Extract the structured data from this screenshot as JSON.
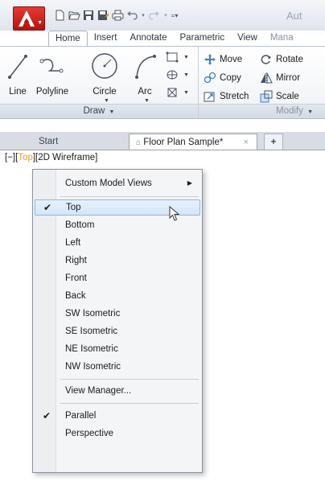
{
  "app": {
    "title_partial": "Aut",
    "title_partial2": "A"
  },
  "ribbon": {
    "tabs": [
      "Home",
      "Insert",
      "Annotate",
      "Parametric",
      "View",
      "Mana"
    ],
    "active_tab": "Home",
    "draw_panel": {
      "title": "Draw",
      "tools": [
        "Line",
        "Polyline",
        "Circle",
        "Arc"
      ]
    },
    "modify_panel": {
      "title": "Modify",
      "tools": [
        "Move",
        "Rotate",
        "Copy",
        "Mirror",
        "Stretch",
        "Scale"
      ]
    }
  },
  "doc_tabs": {
    "start": "Start",
    "file": "Floor Plan Sample*",
    "close": "×",
    "new": "+"
  },
  "viewport": {
    "controls_prefix": "[−][",
    "view": "Top",
    "controls_suffix": "][2D Wireframe]"
  },
  "menu": {
    "items": [
      {
        "label": "Custom Model Views",
        "submenu": true
      },
      {
        "label": "Top",
        "checked": true,
        "hover": true
      },
      {
        "label": "Bottom"
      },
      {
        "label": "Left"
      },
      {
        "label": "Right"
      },
      {
        "label": "Front"
      },
      {
        "label": "Back"
      },
      {
        "label": "SW Isometric"
      },
      {
        "label": "SE Isometric"
      },
      {
        "label": "NE Isometric"
      },
      {
        "label": "NW Isometric"
      },
      {
        "label": "View Manager..."
      },
      {
        "label": "Parallel",
        "checked": true
      },
      {
        "label": "Perspective"
      }
    ]
  },
  "colors": {
    "accent": "#c8201b",
    "hover": "#d3e6fa",
    "view_highlight": "#e0a01c"
  }
}
